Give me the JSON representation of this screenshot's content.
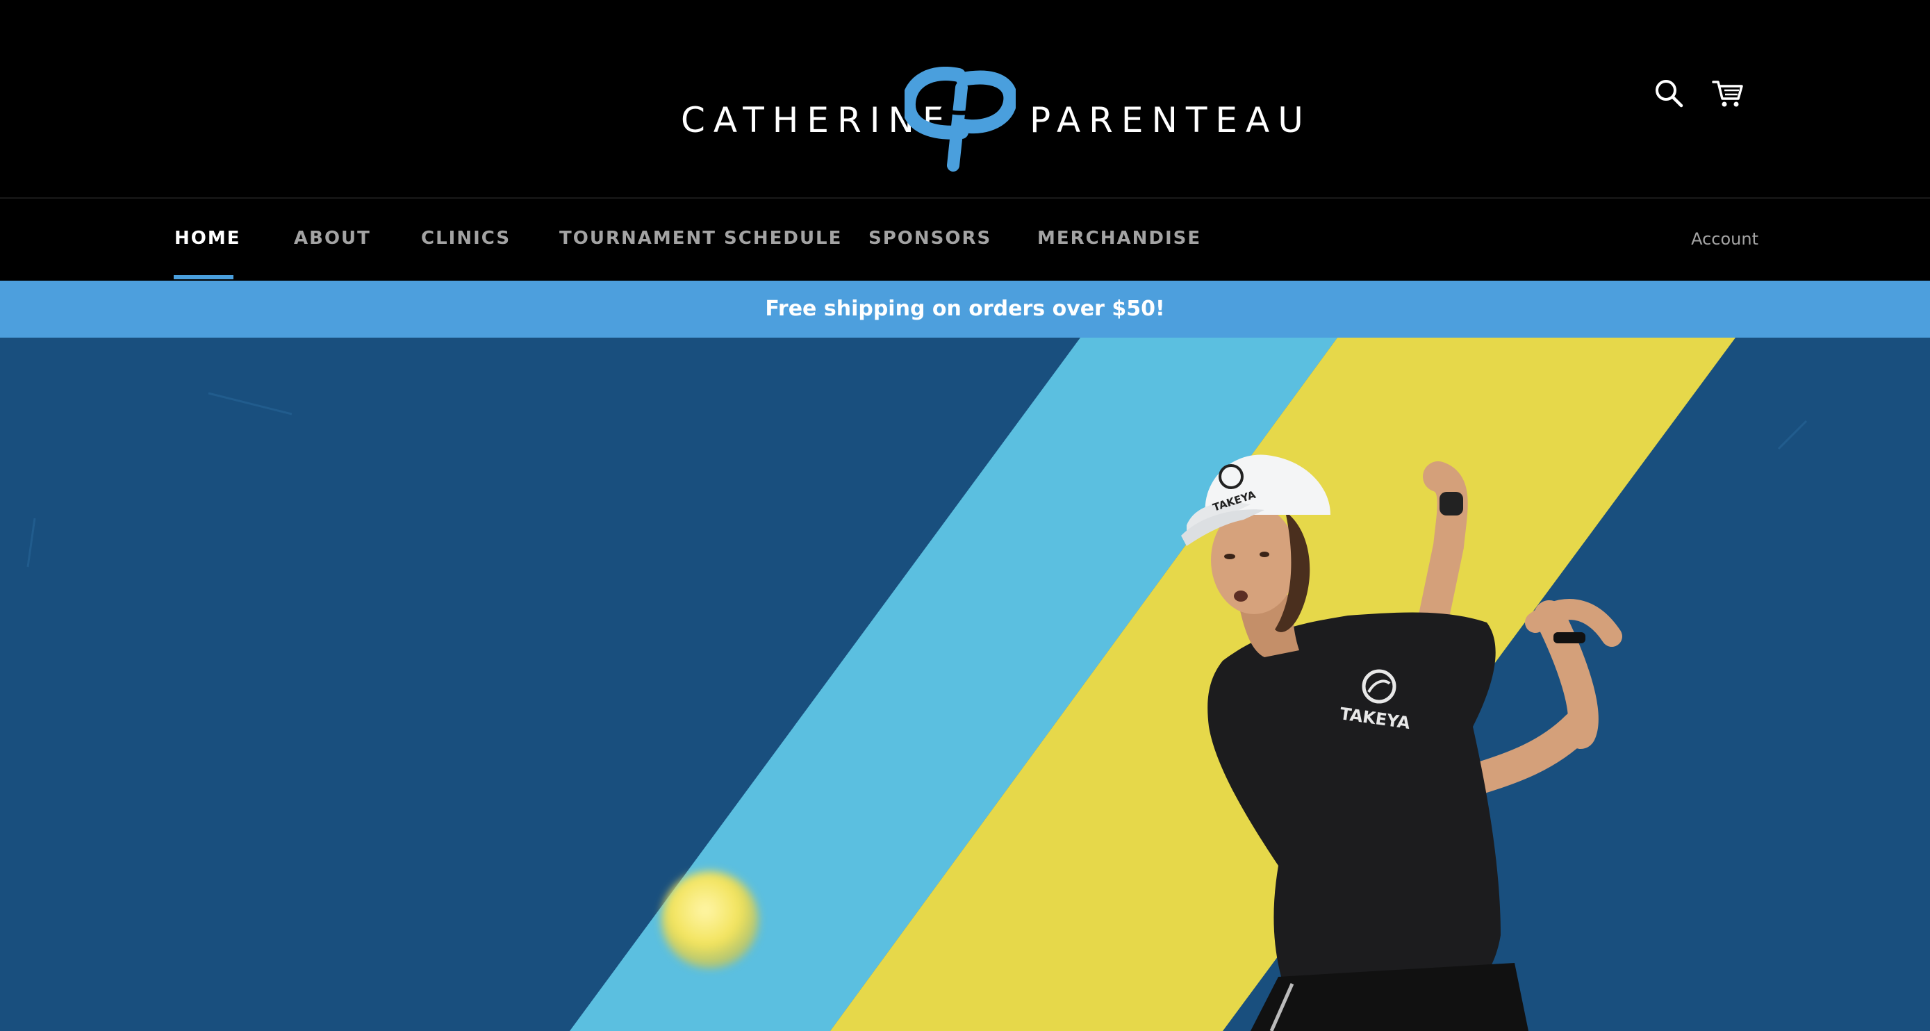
{
  "brand": {
    "first_name": "CATHERINE",
    "last_name": "PARENTEAU",
    "monogram": "CP",
    "accent_color": "#4a9fdd"
  },
  "header": {
    "search_icon": "search-icon",
    "cart_icon": "cart-icon"
  },
  "nav": {
    "items": [
      {
        "label": "HOME",
        "active": true
      },
      {
        "label": "ABOUT",
        "active": false
      },
      {
        "label": "CLINICS",
        "active": false
      },
      {
        "label": "TOURNAMENT SCHEDULE",
        "active": false
      },
      {
        "label": "SPONSORS",
        "active": false
      },
      {
        "label": "MERCHANDISE",
        "active": false
      }
    ],
    "account_label": "Account"
  },
  "announcement": {
    "text": "Free shipping on orders over $50!",
    "background": "#4d9fdd"
  },
  "hero": {
    "sponsor_cap": "TAKEYA",
    "sponsor_shirt": "TAKEYA",
    "colors": {
      "background_blue": "#1d5686",
      "stripe_light_blue": "#5bbfe0",
      "stripe_yellow": "#e6d84a"
    }
  }
}
